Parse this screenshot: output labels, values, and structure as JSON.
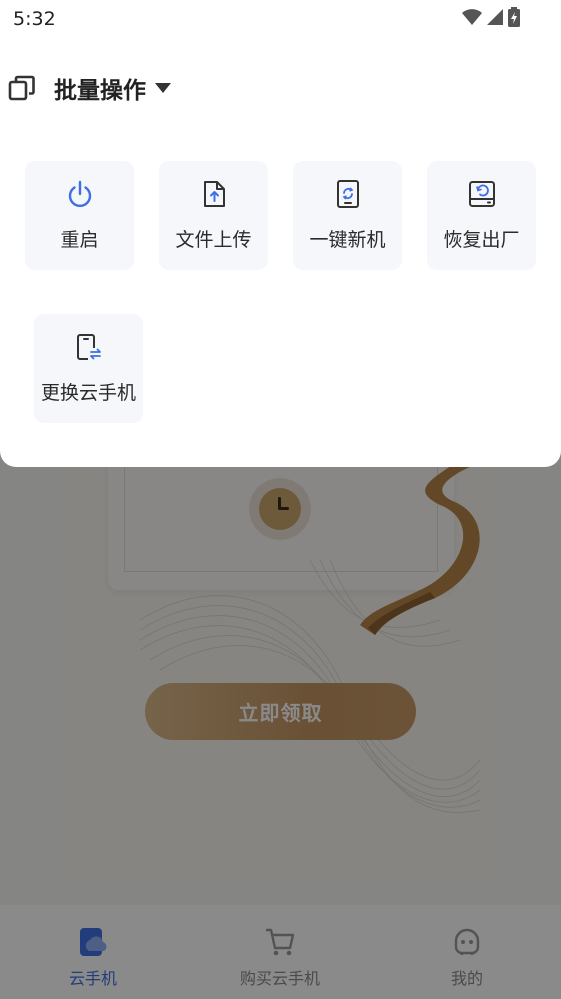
{
  "status_bar": {
    "time": "5:32"
  },
  "header": {
    "title": "批量操作",
    "icon": "multi-window-icon"
  },
  "actions": [
    {
      "label": "重启",
      "icon": "power-icon"
    },
    {
      "label": "文件上传",
      "icon": "file-upload-icon"
    },
    {
      "label": "一键新机",
      "icon": "phone-refresh-icon"
    },
    {
      "label": "恢复出厂",
      "icon": "factory-reset-icon"
    },
    {
      "label": "更换云手机",
      "icon": "phone-swap-icon"
    }
  ],
  "background": {
    "claim_button": "立即领取"
  },
  "tabbar": {
    "items": [
      {
        "label": "云手机",
        "icon": "cloud-phone-icon",
        "active": true
      },
      {
        "label": "购买云手机",
        "icon": "cart-icon",
        "active": false
      },
      {
        "label": "我的",
        "icon": "profile-icon",
        "active": false
      }
    ]
  },
  "colors": {
    "accent": "#3f6fe6",
    "tile_bg": "#f5f7fb",
    "claim_button": "#c49663"
  }
}
